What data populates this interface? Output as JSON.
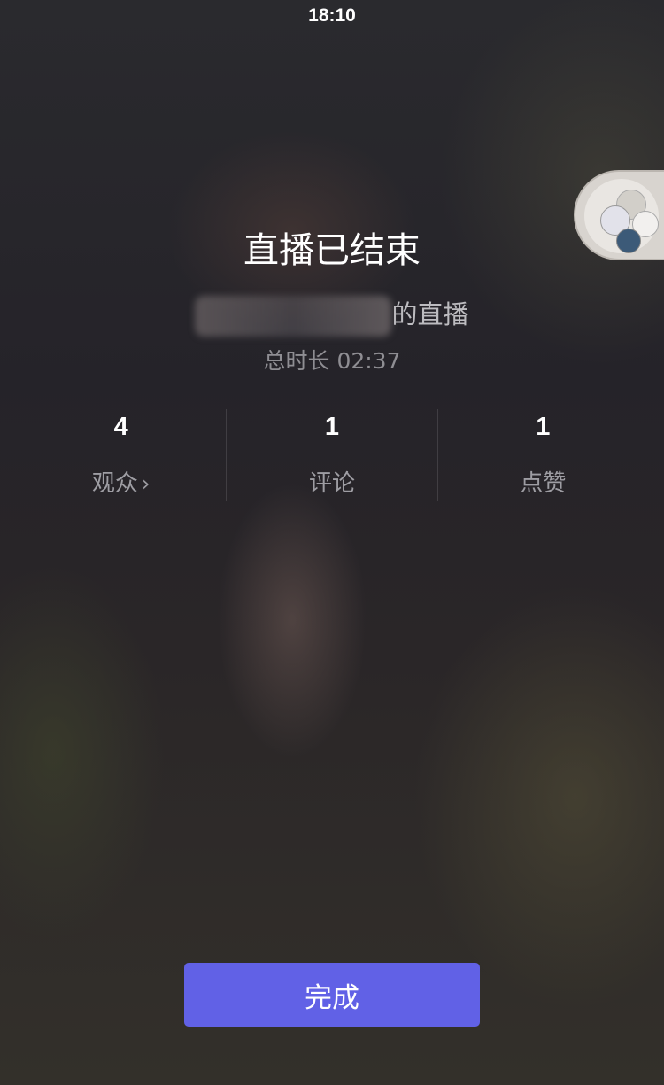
{
  "status_bar": {
    "time": "18:10"
  },
  "summary": {
    "title": "直播已结束",
    "host_suffix": "的直播",
    "duration": "总时长 02:37"
  },
  "stats": [
    {
      "value": "4",
      "label": "观众",
      "chevron": "›"
    },
    {
      "value": "1",
      "label": "评论"
    },
    {
      "value": "1",
      "label": "点赞"
    }
  ],
  "actions": {
    "done_label": "完成"
  },
  "colors": {
    "primary": "#6161e6"
  }
}
